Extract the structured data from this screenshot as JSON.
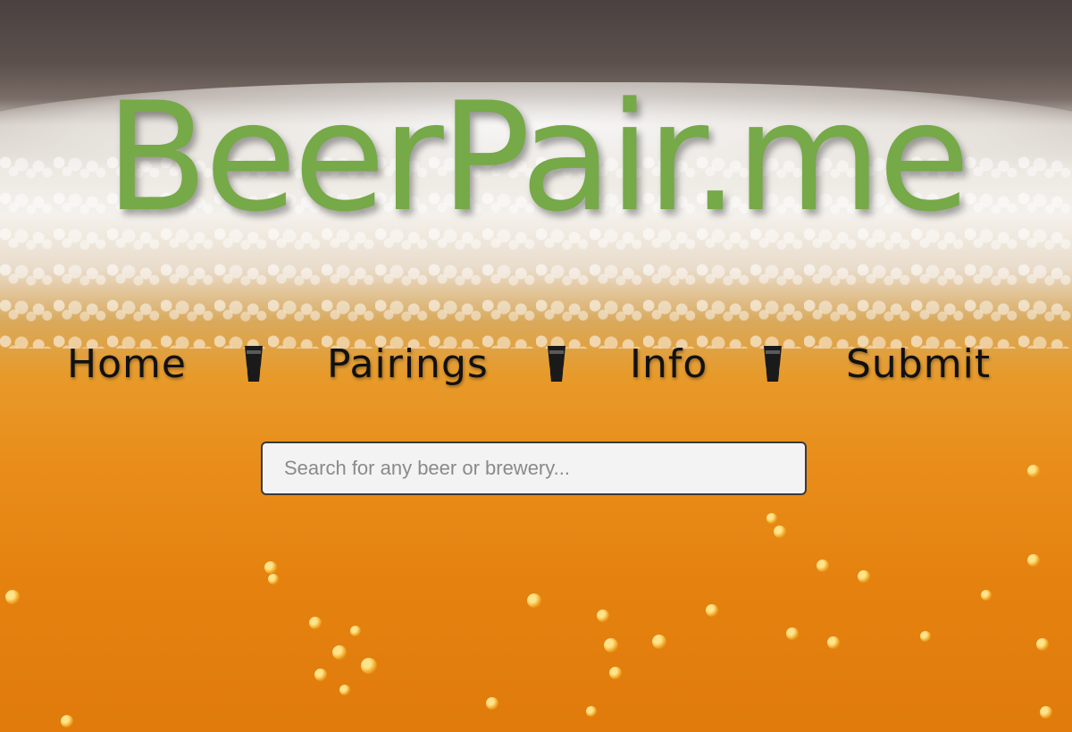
{
  "site": {
    "logo_text": "BeerPair.me",
    "brand_color": "#76a948"
  },
  "nav": {
    "items": [
      {
        "label": "Home"
      },
      {
        "label": "Pairings"
      },
      {
        "label": "Info"
      },
      {
        "label": "Submit"
      }
    ],
    "separator_icon": "pint-glass-icon"
  },
  "search": {
    "placeholder": "Search for any beer or brewery...",
    "value": ""
  }
}
